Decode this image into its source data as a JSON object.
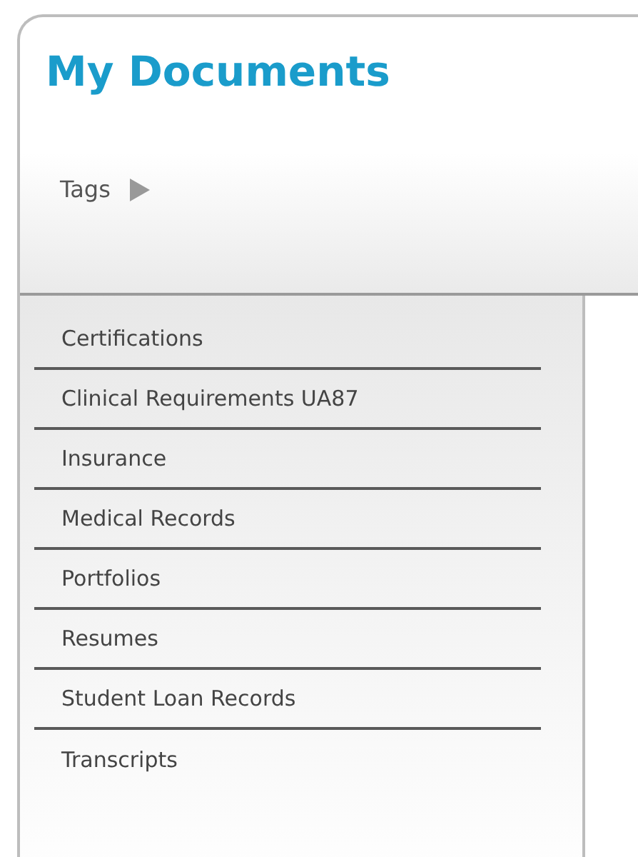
{
  "title": "My Documents",
  "tags_toggle": {
    "label": "Tags"
  },
  "tags": [
    "Certifications",
    "Clinical Requirements UA87",
    "Insurance",
    "Medical Records",
    "Portfolios",
    "Resumes",
    "Student Loan Records",
    "Transcripts"
  ]
}
